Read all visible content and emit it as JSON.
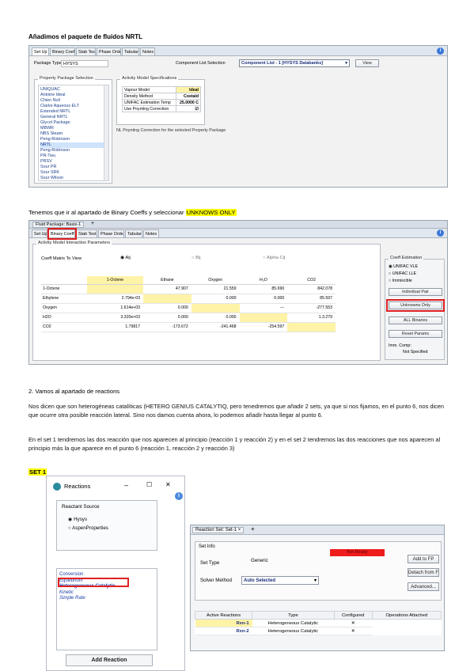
{
  "section1": {
    "heading": "Añadimos el paquete de fluidos NRTL",
    "tabs": [
      "Set Up",
      "Binary Coeffs",
      "Stab Test",
      "Phase Order",
      "Tabular",
      "Notes"
    ],
    "package_type_label": "Package Type:",
    "package_type_value": "HYSYS",
    "component_list_label": "Component List Selection",
    "component_list_value": "Component List - 1 [HYSYS Databanks]",
    "view_button": "View",
    "property_group_title": "Property Package Selection",
    "property_packages": [
      "UNIQUAC",
      "Antoine Ideal",
      "Chien Null",
      "Clarke Aqueous ELT",
      "Extended NRTL",
      "General NRTL",
      "Glycol Package",
      "MBWR",
      "NBS Steam",
      "Peng-Robinson",
      "NRTL",
      "Peng-Robinson",
      "PR-Twu",
      "PRSV",
      "Sour PR",
      "Sour SRK",
      "Sour Wilson",
      "SRK"
    ],
    "selected_package": "NRTL",
    "activity_group_title": "Activity Model Specifications",
    "activity_rows": [
      {
        "label": "Vapour Model",
        "value": "Ideal"
      },
      {
        "label": "Density Method",
        "value": "Costald"
      },
      {
        "label": "UNIFAC Estimation Temp",
        "value": "25.0000 C"
      },
      {
        "label": "Use Poynting Correction",
        "value": "☑"
      }
    ],
    "note": "NL Poynting Correction for the selected Property Package"
  },
  "section2": {
    "text_before": "Tenemos que ir al apartado de Binary Coeffs y seleccionar ",
    "text_highlight": "UNKNOWS ONLY",
    "title_tab": "Fluid Package: Basis-1",
    "tabs": [
      "Set Up",
      "Binary Coeffs",
      "Stab Test",
      "Phase Order",
      "Tabular",
      "Notes"
    ],
    "active_tab": "Binary Coeffs",
    "group_title": "Activity Model Interaction Parameters",
    "matrix_label": "Coeff Matrix To View",
    "radio_aij": "Aij",
    "radio_bij": "Bij",
    "radio_alpha": "Alpha‑Cij",
    "columns": [
      "",
      "1-Octene",
      "Ethane",
      "Oxygen",
      "H₂O",
      "CO2"
    ],
    "rows": [
      {
        "name": "1-Octene",
        "cells": [
          "",
          "47.907",
          "21.559",
          "85.690",
          "842.078"
        ]
      },
      {
        "name": "Ethylene",
        "cells": [
          "2.794e-03",
          "",
          "0.000",
          "0.000",
          "85.597"
        ]
      },
      {
        "name": "Oxygen",
        "cells": [
          "1.614e+03",
          "0.000",
          "",
          "---",
          "-277.553"
        ]
      },
      {
        "name": "H2O",
        "cells": [
          "3.320e+03",
          "0.000",
          "0.000",
          "",
          "1.3.279"
        ]
      },
      {
        "name": "CO2",
        "cells": [
          "1.79817",
          "-173.672",
          "-241.468",
          "-254.597",
          ""
        ]
      }
    ],
    "right_group_title": "Coeff Estimation",
    "right_radios": [
      "UNIFAC VLE",
      "UNIFAC LLE",
      "Immiscible"
    ],
    "right_buttons": [
      "Individual Pair",
      "Unknowns Only",
      "ALL Binaries",
      "Reset Params"
    ],
    "right_footer_label": "Imm. Comp:",
    "right_footer_value": "Not Specified"
  },
  "section3": {
    "heading": "2. Vamos al apartado de reactions",
    "para1": "Nos dicen que son heterogéneas catalíticas (HETERO GENIUS CATALYTIQ, pero tenedremos que añadir 2 sets, ya que si nos fijamos, en el punto 6, nos dicen que ocurre otra posible reacción lateral. Sino nos damos cuenta ahora, lo podemos añadir hasta llegar al punto 6.",
    "para2": "En el set 1 tendremos las dos reacción que nos aparecen al principio (reacción 1 y reacción 2) y en el set 2 tendremos las dos reacciones que nos aparecen al principio más la que aparece en el punto 6 (reacción 1, reacción 2 y reacción 3)",
    "set_label": "SET 1"
  },
  "reactions_dialog": {
    "title": "Reactions",
    "minimize": "–",
    "maximize": "☐",
    "close": "✕",
    "source_title": "Reactant Source",
    "source_options": [
      "Hysys",
      "AspenProperties"
    ],
    "selected_source": "Hysys",
    "types": [
      "Conversion",
      "Equilibrium",
      "Heterogeneous Catalytic",
      "Kinetic",
      "Simple Rate"
    ],
    "selected_type": "Heterogeneous Catalytic",
    "add_button": "Add Reaction"
  },
  "reaction_set": {
    "tab_title": "Reaction Set: Set-1",
    "set_info_title": "Set Info",
    "set_type_label": "Set Type",
    "set_type_value": "Generic",
    "status": "Not Ready",
    "solver_label": "Solver Method",
    "solver_value": "Auto Selected",
    "buttons": [
      "Add to FP",
      "Detach from FP",
      "Advanced..."
    ],
    "table_headers": [
      "Active Reactions",
      "Type",
      "Configured",
      "Operations Attached"
    ],
    "reactions": [
      {
        "name": "Rxn-1",
        "type": "Heterogeneous Catalytic",
        "configured": "✕"
      },
      {
        "name": "Rxn-2",
        "type": "Heterogeneous Catalytic",
        "configured": "✕"
      }
    ]
  }
}
